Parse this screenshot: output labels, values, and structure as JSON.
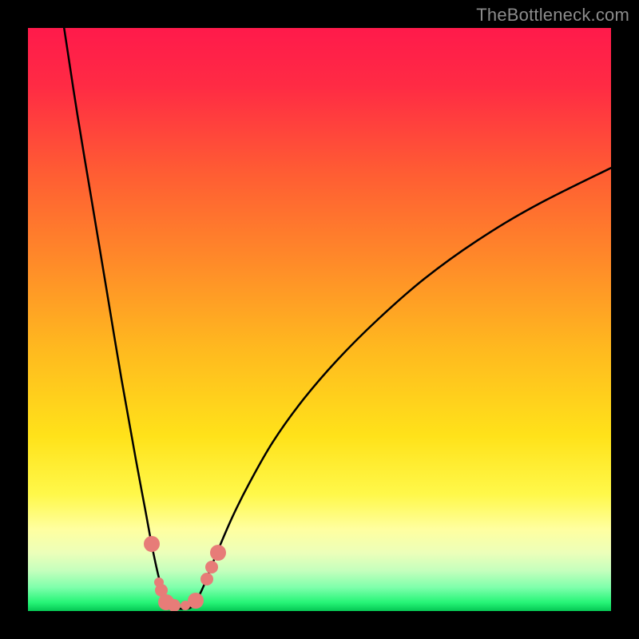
{
  "watermark": "TheBottleneck.com",
  "chart_data": {
    "type": "line",
    "title": "",
    "xlabel": "",
    "ylabel": "",
    "xlim": [
      0,
      100
    ],
    "ylim": [
      0,
      100
    ],
    "gradient_stops": [
      {
        "offset": 0.0,
        "color": "#ff1a4b"
      },
      {
        "offset": 0.1,
        "color": "#ff2b44"
      },
      {
        "offset": 0.25,
        "color": "#ff5d33"
      },
      {
        "offset": 0.4,
        "color": "#ff8a29"
      },
      {
        "offset": 0.55,
        "color": "#ffb91f"
      },
      {
        "offset": 0.7,
        "color": "#ffe21a"
      },
      {
        "offset": 0.8,
        "color": "#fff84a"
      },
      {
        "offset": 0.86,
        "color": "#ffffa0"
      },
      {
        "offset": 0.9,
        "color": "#ecffb9"
      },
      {
        "offset": 0.93,
        "color": "#c6ffbd"
      },
      {
        "offset": 0.96,
        "color": "#7dffab"
      },
      {
        "offset": 0.985,
        "color": "#27f577"
      },
      {
        "offset": 1.0,
        "color": "#05c854"
      }
    ],
    "series": [
      {
        "name": "bottleneck-curve",
        "x": [
          6.2,
          8.5,
          11.0,
          13.5,
          16.0,
          18.5,
          20.0,
          21.5,
          22.9,
          24.0,
          25.0,
          26.0,
          27.4,
          28.5,
          30.0,
          32.0,
          35.0,
          38.0,
          42.0,
          47.0,
          53.0,
          60.0,
          68.0,
          77.0,
          87.0,
          100.0
        ],
        "values": [
          100.0,
          85.0,
          70.0,
          55.0,
          40.0,
          26.0,
          18.0,
          10.0,
          4.0,
          1.2,
          0.4,
          0.4,
          0.4,
          1.2,
          4.0,
          9.0,
          16.0,
          22.0,
          29.0,
          36.0,
          43.0,
          50.0,
          57.0,
          63.5,
          69.5,
          76.0
        ]
      }
    ],
    "marker_points": [
      {
        "x": 21.3,
        "y": 11.5
      },
      {
        "x": 22.5,
        "y": 5.0
      },
      {
        "x": 22.9,
        "y": 3.5
      },
      {
        "x": 23.7,
        "y": 1.5
      },
      {
        "x": 25.0,
        "y": 0.9
      },
      {
        "x": 27.0,
        "y": 0.9
      },
      {
        "x": 28.7,
        "y": 1.8
      },
      {
        "x": 30.7,
        "y": 5.5
      },
      {
        "x": 31.5,
        "y": 7.5
      },
      {
        "x": 32.6,
        "y": 10.0
      }
    ],
    "marker_color": "#e77c78",
    "curve_color": "#000000"
  }
}
